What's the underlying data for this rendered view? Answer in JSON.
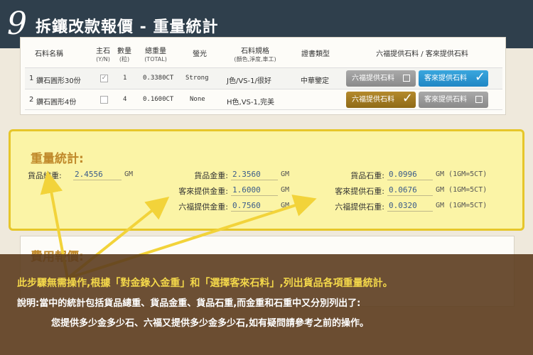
{
  "header": {
    "step": "9",
    "title": "拆鑲改款報價 - 重量統計"
  },
  "table": {
    "columns": [
      {
        "label": "石料名稱",
        "sub": ""
      },
      {
        "label": "主石",
        "sub": "(Y/N)"
      },
      {
        "label": "數量",
        "sub": "(粒)"
      },
      {
        "label": "總重量",
        "sub": "(TOTAL)"
      },
      {
        "label": "螢光",
        "sub": ""
      },
      {
        "label": "石料規格",
        "sub": "(顏色,淨度,車工)"
      },
      {
        "label": "證書類型",
        "sub": ""
      },
      {
        "label": "六福提供石料 / 客來提供石料",
        "sub": ""
      }
    ],
    "rows": [
      {
        "index": "1",
        "name": "鑽石圓形30份",
        "main_stone": true,
        "qty": "1",
        "weight": "0.3380CT",
        "fluorescence": "Strong",
        "spec": "J色/VS-1/很好",
        "cert": "中華鑒定",
        "selected": "customer"
      },
      {
        "index": "2",
        "name": "鑽石圓形4份",
        "main_stone": false,
        "qty": "4",
        "weight": "0.1600CT",
        "fluorescence": "None",
        "spec": "H色,VS-1,完美",
        "cert": "",
        "selected": "lukfook"
      }
    ],
    "btn_lukfook": "六福提供石料",
    "btn_customer": "客來提供石料"
  },
  "weights": {
    "title": "重量統計:",
    "total_label": "貨品總重:",
    "total_value": "2.4556",
    "total_unit": "GM",
    "gold_label": "貨品金重:",
    "gold_value": "2.3560",
    "gold_unit": "GM",
    "cust_gold_label": "客來提供金重:",
    "cust_gold_value": "1.6000",
    "cust_gold_unit": "GM",
    "lf_gold_label": "六福提供金重:",
    "lf_gold_value": "0.7560",
    "lf_gold_unit": "GM",
    "stone_label": "貨品石重:",
    "stone_value": "0.0996",
    "stone_unit": "GM (1GM=5CT)",
    "cust_stone_label": "客來提供石重:",
    "cust_stone_value": "0.0676",
    "cust_stone_unit": "GM (1GM=5CT)",
    "lf_stone_label": "六福提供石重:",
    "lf_stone_value": "0.0320",
    "lf_stone_unit": "GM (1GM=5CT)"
  },
  "lower": {
    "title": "費用報價:"
  },
  "note": {
    "line1": "此步驟無需操作,根據「對金錄入金重」和「選擇客來石料」,列出貨品各項重量統計。",
    "line2": "說明:當中的統計包括貨品總重、貨品金重、貨品石重,而金重和石重中又分別列出了:",
    "line3": "您提供多少金多少石、六福又提供多少金多少石,如有疑問請參考之前的操作。"
  },
  "colors": {
    "header_bg": "#2f3f4c",
    "highlight": "#fbf4a6",
    "highlight_border": "#e6c62a",
    "arrow": "#f2d33a",
    "note_bg": "#5c3c1e",
    "note_accent": "#f4d84a",
    "btn_blue": "#1f86c4",
    "btn_gold": "#8f6a17"
  }
}
